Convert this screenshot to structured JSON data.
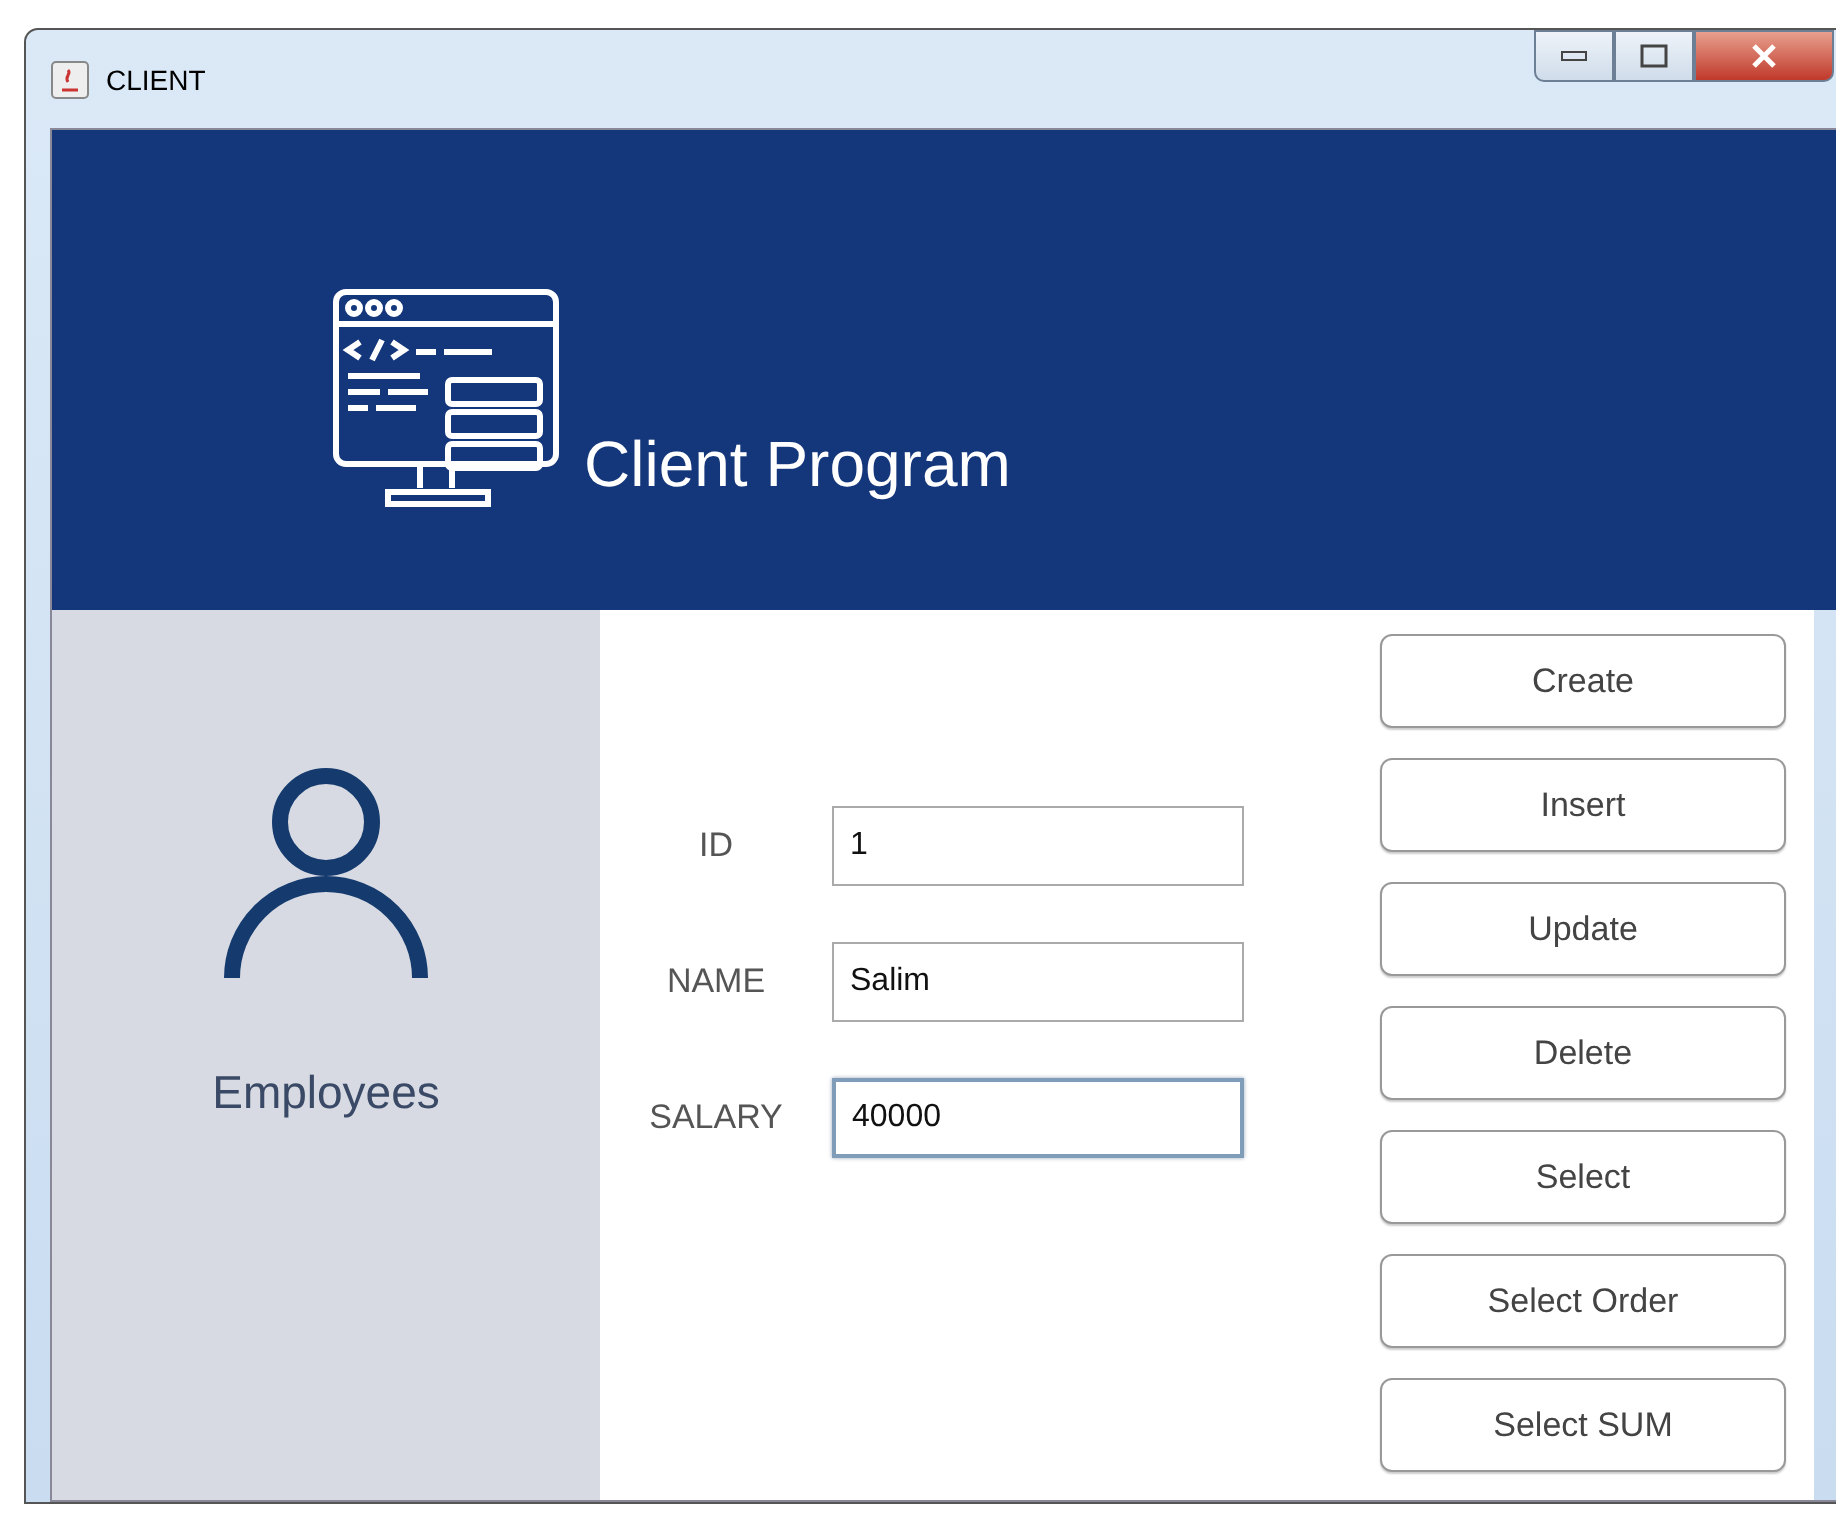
{
  "window": {
    "title": "CLIENT"
  },
  "header": {
    "title": "Client Program"
  },
  "sidebar": {
    "label": "Employees"
  },
  "fields": [
    {
      "label": "ID",
      "value": "1",
      "focused": false
    },
    {
      "label": "NAME",
      "value": "Salim",
      "focused": false
    },
    {
      "label": "SALARY",
      "value": "40000",
      "focused": true
    }
  ],
  "buttons": [
    "Create",
    "Insert",
    "Update",
    "Delete",
    "Select",
    "Select Order",
    "Select SUM"
  ]
}
